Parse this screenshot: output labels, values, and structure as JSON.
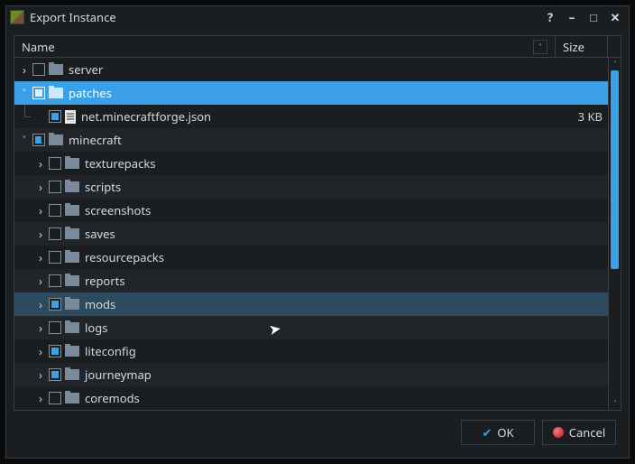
{
  "window": {
    "title": "Export Instance"
  },
  "columns": {
    "name": "Name",
    "size": "Size"
  },
  "tree": [
    {
      "label": "server",
      "depth": 0,
      "expandable": true,
      "expanded": false,
      "check": "none",
      "icon": "folder",
      "selected": false,
      "size": ""
    },
    {
      "label": "patches",
      "depth": 0,
      "expandable": true,
      "expanded": true,
      "check": "full",
      "icon": "folder",
      "selected": true,
      "size": ""
    },
    {
      "label": "net.minecraftforge.json",
      "depth": 1,
      "expandable": false,
      "expanded": false,
      "check": "full",
      "icon": "file",
      "selected": false,
      "size": "3 KB",
      "guide": "end"
    },
    {
      "label": "minecraft",
      "depth": 0,
      "expandable": true,
      "expanded": true,
      "check": "half",
      "icon": "folder",
      "selected": false,
      "size": ""
    },
    {
      "label": "texturepacks",
      "depth": 1,
      "expandable": true,
      "expanded": false,
      "check": "none",
      "icon": "folder",
      "selected": false,
      "size": ""
    },
    {
      "label": "scripts",
      "depth": 1,
      "expandable": true,
      "expanded": false,
      "check": "none",
      "icon": "folder",
      "selected": false,
      "size": ""
    },
    {
      "label": "screenshots",
      "depth": 1,
      "expandable": true,
      "expanded": false,
      "check": "none",
      "icon": "folder",
      "selected": false,
      "size": ""
    },
    {
      "label": "saves",
      "depth": 1,
      "expandable": true,
      "expanded": false,
      "check": "none",
      "icon": "folder",
      "selected": false,
      "size": ""
    },
    {
      "label": "resourcepacks",
      "depth": 1,
      "expandable": true,
      "expanded": false,
      "check": "none",
      "icon": "folder",
      "selected": false,
      "size": ""
    },
    {
      "label": "reports",
      "depth": 1,
      "expandable": true,
      "expanded": false,
      "check": "none",
      "icon": "folder",
      "selected": false,
      "size": ""
    },
    {
      "label": "mods",
      "depth": 1,
      "expandable": true,
      "expanded": false,
      "check": "full",
      "icon": "folder",
      "selected": false,
      "size": "",
      "hovered": true
    },
    {
      "label": "logs",
      "depth": 1,
      "expandable": true,
      "expanded": false,
      "check": "none",
      "icon": "folder",
      "selected": false,
      "size": ""
    },
    {
      "label": "liteconfig",
      "depth": 1,
      "expandable": true,
      "expanded": false,
      "check": "full",
      "icon": "folder",
      "selected": false,
      "size": ""
    },
    {
      "label": "journeymap",
      "depth": 1,
      "expandable": true,
      "expanded": false,
      "check": "full",
      "icon": "folder",
      "selected": false,
      "size": ""
    },
    {
      "label": "coremods",
      "depth": 1,
      "expandable": true,
      "expanded": false,
      "check": "none",
      "icon": "folder",
      "selected": false,
      "size": ""
    }
  ],
  "buttons": {
    "ok": "OK",
    "cancel": "Cancel"
  }
}
